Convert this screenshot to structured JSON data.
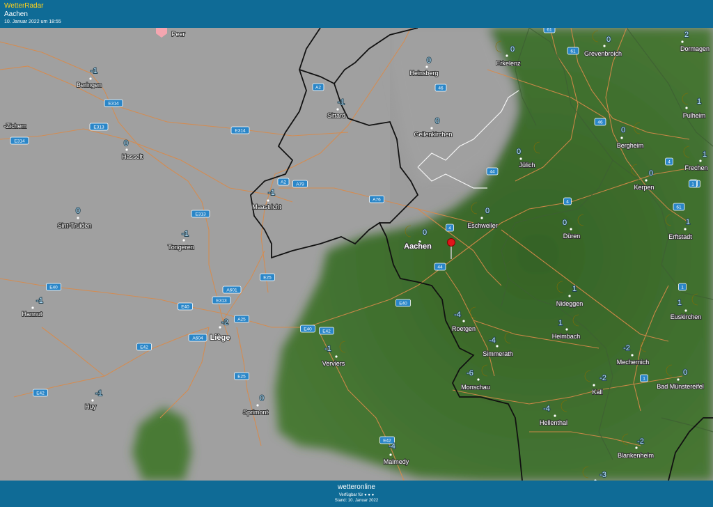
{
  "header": {
    "brand": "WetterRadar",
    "location": "Aachen",
    "timestamp": "10. Januar 2022 um 18:55"
  },
  "footer": {
    "logo": "wetteronline",
    "available": "Verfügbar für ● ● ●",
    "stand": "Stand: 10. Januar 2022"
  },
  "colors": {
    "bar": "#0f6b96",
    "brand": "#ffd21a",
    "land": "#9c9c9c",
    "radar": "#3f6f2c",
    "road": "#d98a4a",
    "border": "#111111",
    "shield": "#2a86c8",
    "moon": "#ffd200"
  },
  "map_icons": {
    "moon": "crescent-moon-icon",
    "pin": "location-pin-icon"
  },
  "cities": [
    {
      "name": "Peer",
      "temp": ""
    },
    {
      "name": "Beringen",
      "temp": "-1"
    },
    {
      "name": "Hasselt",
      "temp": "0"
    },
    {
      "name": "Sint-Truiden",
      "temp": "0"
    },
    {
      "name": "Tongeren",
      "temp": "-1"
    },
    {
      "name": "Hannut",
      "temp": "-1"
    },
    {
      "name": "Huy",
      "temp": "-1"
    },
    {
      "name": "Liège",
      "temp": "-2"
    },
    {
      "name": "Sprimont",
      "temp": "0"
    },
    {
      "name": "Maastricht",
      "temp": "-1"
    },
    {
      "name": "Sittard",
      "temp": "-1"
    },
    {
      "name": "Heinsberg",
      "temp": "0"
    },
    {
      "name": "Geilenkirchen",
      "temp": "0"
    },
    {
      "name": "Aachen",
      "temp": "0"
    },
    {
      "name": "Erkelenz",
      "temp": "0"
    },
    {
      "name": "Grevenbroich",
      "temp": "0"
    },
    {
      "name": "Dormagen",
      "temp": "2"
    },
    {
      "name": "Pulheim",
      "temp": "1"
    },
    {
      "name": "Bergheim",
      "temp": "0"
    },
    {
      "name": "Jülich",
      "temp": "0"
    },
    {
      "name": "Frechen",
      "temp": "1"
    },
    {
      "name": "Kerpen",
      "temp": "0"
    },
    {
      "name": "Eschweiler",
      "temp": "0"
    },
    {
      "name": "Düren",
      "temp": "0"
    },
    {
      "name": "Erftstadt",
      "temp": "1"
    },
    {
      "name": "Nideggen",
      "temp": "1"
    },
    {
      "name": "Euskirchen",
      "temp": "1"
    },
    {
      "name": "Roetgen",
      "temp": "-4"
    },
    {
      "name": "Heimbach",
      "temp": "1"
    },
    {
      "name": "Simmerath",
      "temp": "-4"
    },
    {
      "name": "Mechernich",
      "temp": "-2"
    },
    {
      "name": "Monschau",
      "temp": "-6"
    },
    {
      "name": "Kall",
      "temp": "-2"
    },
    {
      "name": "Bad Münstereifel",
      "temp": "0"
    },
    {
      "name": "Verviers",
      "temp": "-1"
    },
    {
      "name": "Hellenthal",
      "temp": "-4"
    },
    {
      "name": "Blankenheim",
      "temp": "-2"
    },
    {
      "name": "Malmedy",
      "temp": "-4"
    },
    {
      "name": "-Zichem",
      "temp": ""
    },
    {
      "name": "",
      "temp": "-3"
    }
  ],
  "roads": [
    "E314",
    "E313",
    "E314",
    "E314",
    "E313",
    "A2",
    "A2",
    "A79",
    "A76",
    "E25",
    "A601",
    "E313",
    "E40",
    "E40",
    "E40",
    "E42",
    "A604",
    "A25",
    "E42",
    "E25",
    "E42",
    "E42",
    "E40",
    "44",
    "44",
    "4",
    "4",
    "46",
    "61",
    "46",
    "61",
    "4",
    "4",
    "1",
    "61",
    "1",
    "1",
    "1"
  ]
}
